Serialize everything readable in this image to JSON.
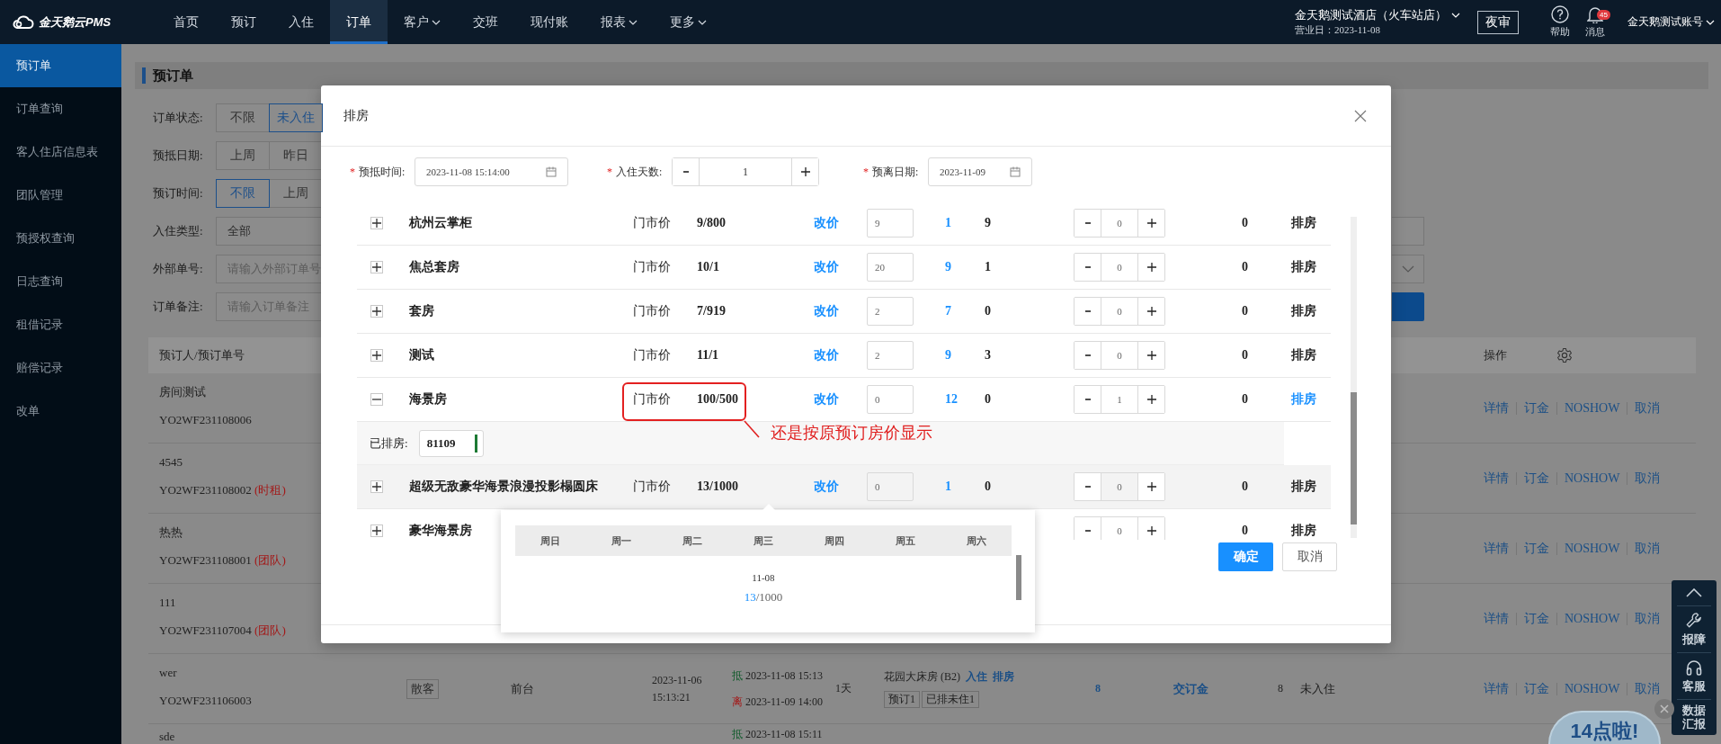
{
  "top_nav": {
    "logo": "金天鹅云PMS",
    "items": [
      {
        "label": "首页",
        "selected": false,
        "dropdown": false
      },
      {
        "label": "预订",
        "selected": false,
        "dropdown": false
      },
      {
        "label": "入住",
        "selected": false,
        "dropdown": false
      },
      {
        "label": "订单",
        "selected": true,
        "dropdown": false
      },
      {
        "label": "客户",
        "selected": false,
        "dropdown": true
      },
      {
        "label": "交班",
        "selected": false,
        "dropdown": false
      },
      {
        "label": "现付账",
        "selected": false,
        "dropdown": false
      },
      {
        "label": "报表",
        "selected": false,
        "dropdown": true
      },
      {
        "label": "更多",
        "selected": false,
        "dropdown": true
      }
    ],
    "hotel": "金天鹅测试酒店（火车站店）",
    "business_day": "营业日：2023-11-08",
    "night_audit": "夜审",
    "help": "帮助",
    "messages": "消息",
    "message_count": "45",
    "account": "金天鹅测试账号"
  },
  "sidebar": {
    "items": [
      {
        "label": "预订单",
        "selected": true
      },
      {
        "label": "订单查询",
        "selected": false
      },
      {
        "label": "客人住店信息表",
        "selected": false
      },
      {
        "label": "团队管理",
        "selected": false
      },
      {
        "label": "预授权查询",
        "selected": false
      },
      {
        "label": "日志查询",
        "selected": false
      },
      {
        "label": "租借记录",
        "selected": false
      },
      {
        "label": "赔偿记录",
        "selected": false
      },
      {
        "label": "改单",
        "selected": false
      }
    ]
  },
  "page": {
    "title": "预订单",
    "filters": [
      {
        "label": "订单状态:",
        "kind": "buttons",
        "options": [
          {
            "label": "不限",
            "selected": false
          },
          {
            "label": "未入住",
            "selected": true
          }
        ]
      },
      {
        "label": "预抵日期:",
        "kind": "buttons",
        "options": [
          {
            "label": "上周",
            "selected": false
          },
          {
            "label": "昨日",
            "selected": false
          }
        ]
      },
      {
        "label": "预订时间:",
        "kind": "buttons",
        "options": [
          {
            "label": "不限",
            "selected": true
          },
          {
            "label": "上周",
            "selected": false
          }
        ]
      },
      {
        "label": "入住类型:",
        "kind": "select",
        "value": "全部"
      },
      {
        "label": "外部单号:",
        "kind": "input",
        "placeholder": "请输入外部订单号"
      },
      {
        "label": "订单备注:",
        "kind": "input",
        "placeholder": "请输入订单备注"
      }
    ],
    "table": {
      "columns": [
        {
          "label": "预订人/预订单号"
        },
        {
          "label": "操作"
        }
      ],
      "rows": [
        {
          "guest": "房间测试",
          "order_no": "YO2WF231108006",
          "actions": [
            "详情",
            "订金",
            "NOSHOW",
            "取消"
          ]
        },
        {
          "guest": "4545",
          "order_no": "YO2WF231108002",
          "order_tag": "(时租)",
          "actions": [
            "详情",
            "订金",
            "NOSHOW",
            "取消"
          ]
        },
        {
          "guest": "热热",
          "order_no": "YO2WF231108001",
          "order_tag": "(团队)",
          "actions": [
            "详情",
            "订金",
            "NOSHOW",
            "取消"
          ]
        },
        {
          "guest": "111",
          "order_no": "YO2WF231107004",
          "order_tag": "(团队)",
          "actions": [
            "详情",
            "订金",
            "NOSHOW",
            "取消"
          ]
        },
        {
          "guest": "wer",
          "order_no": "YO2WF231106003",
          "type_tag": "散客",
          "source": "前台",
          "created": "2023-11-06 15:13:21",
          "arrival_mark": "抵",
          "arrival": "2023-11-08 15:13",
          "departure_mark": "离",
          "departure": "2023-11-09 14:00",
          "nights": "1天",
          "room": "花园大床房 (B2)",
          "room_links": [
            "入住",
            "排房"
          ],
          "room_tags": [
            "预订1",
            "已排未住1"
          ],
          "column_8": "8",
          "deposit_link": "交订金",
          "column_10": "8",
          "status": "未入住",
          "actions": [
            "详情",
            "订金",
            "NOSHOW",
            "取消"
          ]
        },
        {
          "guest": "sde",
          "arrival_mark": "抵",
          "arrival": "2023-11-08 15:11"
        }
      ]
    }
  },
  "dialog": {
    "title": "排房",
    "fields": [
      {
        "required_mark": "*",
        "label": "预抵时间:",
        "kind": "date",
        "value": "2023-11-08 15:14:00"
      },
      {
        "required_mark": "*",
        "label": "入住天数:",
        "kind": "stepper",
        "value": "1"
      },
      {
        "required_mark": "*",
        "label": "预离日期:",
        "kind": "date",
        "value": "2023-11-09"
      }
    ],
    "room_types": [
      {
        "expanded": false,
        "hovered": false,
        "name": "杭州云掌柜",
        "price_type": "门市价",
        "rate": "9/800",
        "change_price": "改价",
        "quantity": "9",
        "available": "1",
        "column_7": "9",
        "rooms": "0",
        "total": "0",
        "action": "排房",
        "selected": false
      },
      {
        "expanded": false,
        "hovered": false,
        "name": "焦总套房",
        "price_type": "门市价",
        "rate": "10/1",
        "change_price": "改价",
        "quantity": "20",
        "available": "9",
        "column_7": "1",
        "rooms": "0",
        "total": "0",
        "action": "排房",
        "selected": false
      },
      {
        "expanded": false,
        "hovered": false,
        "name": "套房",
        "price_type": "门市价",
        "rate": "7/919",
        "change_price": "改价",
        "quantity": "2",
        "available": "7",
        "column_7": "0",
        "rooms": "0",
        "total": "0",
        "action": "排房",
        "selected": false
      },
      {
        "expanded": false,
        "hovered": false,
        "name": "测试",
        "price_type": "门市价",
        "rate": "11/1",
        "change_price": "改价",
        "quantity": "2",
        "available": "9",
        "column_7": "3",
        "rooms": "0",
        "total": "0",
        "action": "排房",
        "selected": false
      },
      {
        "expanded": true,
        "hovered": false,
        "name": "海景房",
        "price_type": "门市价",
        "rate": "100/500",
        "change_price": "改价",
        "quantity": "0",
        "available": "12",
        "column_7": "0",
        "rooms": "1",
        "total": "0",
        "action": "排房",
        "selected": true,
        "assigned_label": "已排房:",
        "assigned_rooms": [
          "81109"
        ]
      },
      {
        "expanded": false,
        "hovered": true,
        "name": "超级无敌豪华海景浪漫投影榻圆床",
        "price_type": "门市价",
        "rate": "13/1000",
        "change_price": "改价",
        "quantity": "0",
        "available": "1",
        "column_7": "0",
        "rooms": "0",
        "total": "0",
        "action": "排房",
        "selected": false
      },
      {
        "expanded": false,
        "hovered": false,
        "name": "豪华海景房",
        "rooms": "0",
        "total": "0",
        "action": "排房",
        "selected": false
      }
    ],
    "annotation": "还是按原预订房价显示",
    "calendar_popover": {
      "weekdays": [
        "周日",
        "周一",
        "周二",
        "周三",
        "周四",
        "周五",
        "周六"
      ],
      "date": "11-08",
      "booked": "13",
      "total": "/1000"
    },
    "buttons": [
      {
        "label": "确定",
        "kind": "primary"
      },
      {
        "label": "取消",
        "kind": "default"
      }
    ]
  },
  "float_toolbar": {
    "items": [
      {
        "kind": "top"
      },
      {
        "kind": "report",
        "label": "报障"
      },
      {
        "kind": "service",
        "label": "客服"
      },
      {
        "kind": "data",
        "label": "数据汇报"
      }
    ]
  },
  "promo": {
    "text": "14点啦!"
  }
}
